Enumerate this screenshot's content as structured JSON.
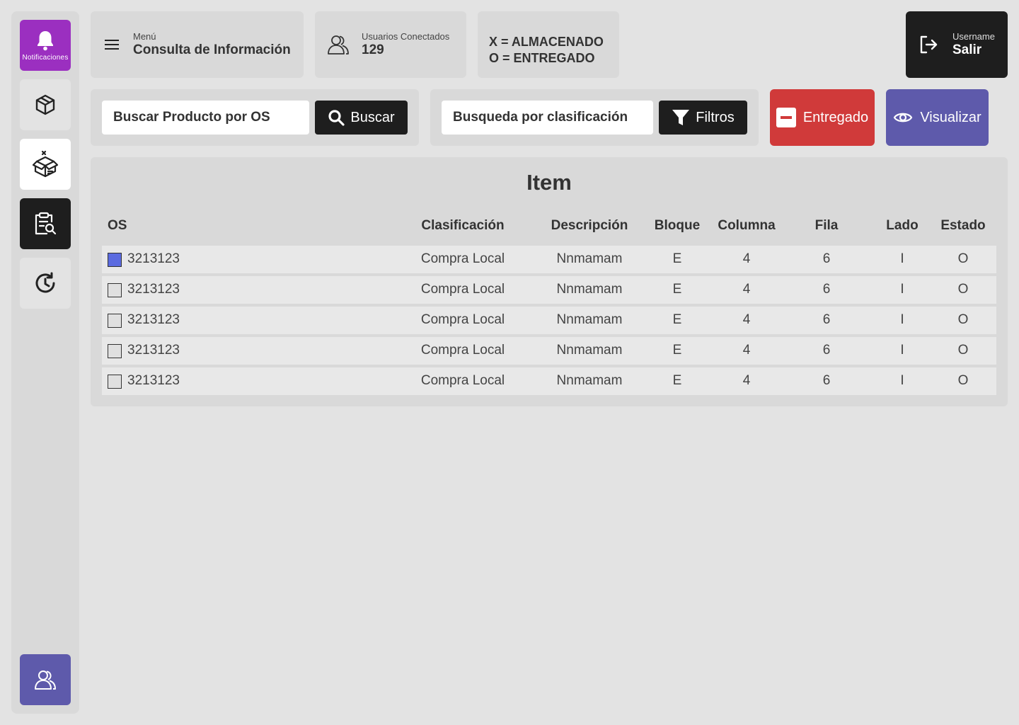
{
  "sidebar": {
    "notifications_label": "Notificaciones",
    "icons": [
      "bell-icon",
      "box-icon",
      "open-box-icon",
      "clipboard-search-icon",
      "history-icon",
      "users-icon"
    ]
  },
  "header": {
    "menu_label": "Menú",
    "menu_title": "Consulta de Información",
    "users_label": "Usuarios Conectados",
    "users_count": "129",
    "legend_x": "X = ALMACENADO",
    "legend_o": "O = ENTREGADO",
    "username_label": "Username",
    "exit_label": "Salir"
  },
  "search": {
    "placeholder": "Buscar Producto por OS",
    "button_label": "Buscar"
  },
  "filter": {
    "placeholder": "Busqueda por clasificación",
    "button_label": "Filtros"
  },
  "actions": {
    "delivered_label": "Entregado",
    "view_label": "Visualizar",
    "delivered_color": "#d03a3a",
    "view_color": "#5e5aab"
  },
  "table": {
    "title": "Item",
    "headers": [
      "OS",
      "Clasificación",
      "Descripción",
      "Bloque",
      "Columna",
      "Fila",
      "Lado",
      "Estado"
    ],
    "rows": [
      {
        "selected": true,
        "os": "3213123",
        "clasificacion": "Compra Local",
        "descripcion": "Nnmamam",
        "bloque": "E",
        "columna": "4",
        "fila": "6",
        "lado": "I",
        "estado": "O"
      },
      {
        "selected": false,
        "os": "3213123",
        "clasificacion": "Compra Local",
        "descripcion": "Nnmamam",
        "bloque": "E",
        "columna": "4",
        "fila": "6",
        "lado": "I",
        "estado": "O"
      },
      {
        "selected": false,
        "os": "3213123",
        "clasificacion": "Compra Local",
        "descripcion": "Nnmamam",
        "bloque": "E",
        "columna": "4",
        "fila": "6",
        "lado": "I",
        "estado": "O"
      },
      {
        "selected": false,
        "os": "3213123",
        "clasificacion": "Compra Local",
        "descripcion": "Nnmamam",
        "bloque": "E",
        "columna": "4",
        "fila": "6",
        "lado": "I",
        "estado": "O"
      },
      {
        "selected": false,
        "os": "3213123",
        "clasificacion": "Compra Local",
        "descripcion": "Nnmamam",
        "bloque": "E",
        "columna": "4",
        "fila": "6",
        "lado": "I",
        "estado": "O"
      }
    ]
  }
}
